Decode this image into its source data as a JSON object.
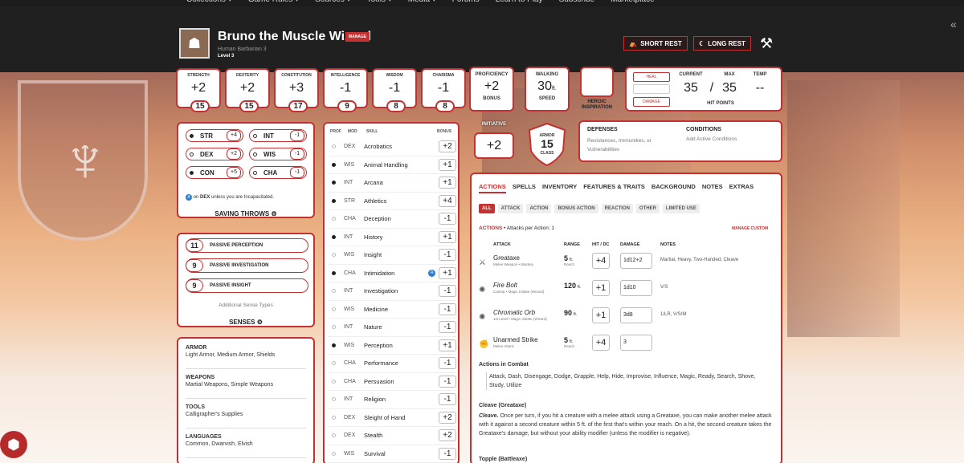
{
  "nav": {
    "items": [
      "Collections ▾",
      "Game Rules ▾",
      "Sources ▾",
      "Tools ▾",
      "Media ▾",
      "Forums",
      "Learn to Play",
      "Subscribe",
      "Marketplace"
    ]
  },
  "character": {
    "name": "Bruno the Muscle Wizard",
    "manage": "MANAGE",
    "subtitle": "Human  Barbarian 3",
    "level": "Level 3"
  },
  "rest": {
    "short": "SHORT REST",
    "long": "LONG REST"
  },
  "abilities": [
    {
      "label": "STRENGTH",
      "mod": "+2",
      "score": "15"
    },
    {
      "label": "DEXTERITY",
      "mod": "+2",
      "score": "15"
    },
    {
      "label": "CONSTITUTION",
      "mod": "+3",
      "score": "17"
    },
    {
      "label": "INTELLIGENCE",
      "mod": "-1",
      "score": "9"
    },
    {
      "label": "WISDOM",
      "mod": "-1",
      "score": "8"
    },
    {
      "label": "CHARISMA",
      "mod": "-1",
      "score": "8"
    }
  ],
  "proficiency": {
    "label": "PROFICIENCY",
    "value": "+2",
    "sub": "BONUS"
  },
  "speed": {
    "label": "WALKING",
    "value": "30",
    "unit": "ft.",
    "sub": "SPEED"
  },
  "heroic": {
    "label": "HEROIC INSPIRATION"
  },
  "hp": {
    "heal": "HEAL",
    "damage": "DAMAGE",
    "current_label": "CURRENT",
    "max_label": "MAX",
    "temp_label": "TEMP",
    "current": "35",
    "sep": "/",
    "max": "35",
    "temp": "--",
    "title": "HIT POINTS"
  },
  "saves": {
    "rows": [
      {
        "name": "STR",
        "value": "+4",
        "prof": true
      },
      {
        "name": "INT",
        "value": "-1",
        "prof": false
      },
      {
        "name": "DEX",
        "value": "+2",
        "prof": false
      },
      {
        "name": "WIS",
        "value": "-1",
        "prof": false
      },
      {
        "name": "CON",
        "value": "+5",
        "prof": true
      },
      {
        "name": "CHA",
        "value": "-1",
        "prof": false
      }
    ],
    "note_pre": "on",
    "note_bold": "DEX",
    "note_post": "unless you are Incapacitated.",
    "title": "SAVING THROWS"
  },
  "senses": {
    "rows": [
      {
        "value": "11",
        "label": "PASSIVE PERCEPTION"
      },
      {
        "value": "9",
        "label": "PASSIVE INVESTIGATION"
      },
      {
        "value": "9",
        "label": "PASSIVE INSIGHT"
      }
    ],
    "additional": "Additional Sense Types",
    "title": "SENSES"
  },
  "proficiencies": [
    {
      "heading": "ARMOR",
      "text": "Light Armor, Medium Armor, Shields"
    },
    {
      "heading": "WEAPONS",
      "text": "Martial Weapons, Simple Weapons"
    },
    {
      "heading": "TOOLS",
      "text": "Calligrapher's Supplies"
    },
    {
      "heading": "LANGUAGES",
      "text": "Common, Dwarvish, Elvish"
    }
  ],
  "skills_header": {
    "prof": "PROF",
    "mod": "MOD",
    "skill": "SKILL",
    "bonus": "BONUS"
  },
  "skills": [
    {
      "mod": "DEX",
      "name": "Acrobatics",
      "bonus": "+2",
      "prof": false
    },
    {
      "mod": "WIS",
      "name": "Animal Handling",
      "bonus": "+1",
      "prof": true
    },
    {
      "mod": "INT",
      "name": "Arcana",
      "bonus": "+1",
      "prof": true
    },
    {
      "mod": "STR",
      "name": "Athletics",
      "bonus": "+4",
      "prof": true
    },
    {
      "mod": "CHA",
      "name": "Deception",
      "bonus": "-1",
      "prof": false
    },
    {
      "mod": "INT",
      "name": "History",
      "bonus": "+1",
      "prof": true
    },
    {
      "mod": "WIS",
      "name": "Insight",
      "bonus": "-1",
      "prof": false
    },
    {
      "mod": "CHA",
      "name": "Intimidation",
      "bonus": "+1",
      "prof": true,
      "adv": "A"
    },
    {
      "mod": "INT",
      "name": "Investigation",
      "bonus": "-1",
      "prof": false
    },
    {
      "mod": "WIS",
      "name": "Medicine",
      "bonus": "-1",
      "prof": false
    },
    {
      "mod": "INT",
      "name": "Nature",
      "bonus": "-1",
      "prof": false
    },
    {
      "mod": "WIS",
      "name": "Perception",
      "bonus": "+1",
      "prof": true
    },
    {
      "mod": "CHA",
      "name": "Performance",
      "bonus": "-1",
      "prof": false
    },
    {
      "mod": "CHA",
      "name": "Persuasion",
      "bonus": "-1",
      "prof": false
    },
    {
      "mod": "INT",
      "name": "Religion",
      "bonus": "-1",
      "prof": false
    },
    {
      "mod": "DEX",
      "name": "Sleight of Hand",
      "bonus": "+2",
      "prof": false
    },
    {
      "mod": "DEX",
      "name": "Stealth",
      "bonus": "+2",
      "prof": false
    },
    {
      "mod": "WIS",
      "name": "Survival",
      "bonus": "-1",
      "prof": false
    }
  ],
  "initiative": {
    "label": "INITIATIVE",
    "value": "+2"
  },
  "armor": {
    "top": "ARMOR",
    "value": "15",
    "bottom": "CLASS"
  },
  "defenses": {
    "title": "DEFENSES",
    "text": "Resistances, Immunities, or Vulnerabilities"
  },
  "conditions": {
    "title": "CONDITIONS",
    "text": "Add Active Conditions"
  },
  "tabs": [
    "ACTIONS",
    "SPELLS",
    "INVENTORY",
    "FEATURES & TRAITS",
    "BACKGROUND",
    "NOTES",
    "EXTRAS"
  ],
  "filters": [
    "ALL",
    "ATTACK",
    "ACTION",
    "BONUS ACTION",
    "REACTION",
    "OTHER",
    "LIMITED USE"
  ],
  "actions": {
    "title": "ACTIONS",
    "per_action": "• Attacks per Action: 1",
    "manage_custom": "MANAGE CUSTOM",
    "col_attack": "ATTACK",
    "col_range": "RANGE",
    "col_hit": "HIT / DC",
    "col_damage": "DAMAGE",
    "col_notes": "NOTES",
    "attacks": [
      {
        "icon": "⚔",
        "name": "Greataxe",
        "sub": "Melee Weapon • Mastery",
        "range": "5",
        "range_unit": "ft.",
        "range_sub": "Reach",
        "hit": "+4",
        "damage": "1d12+2",
        "notes": "Martial, Heavy, Two-Handed, Cleave"
      },
      {
        "icon": "✺",
        "name": "Fire Bolt",
        "sub": "Cantrip • Magic Initiate (Wizard)",
        "range": "120",
        "range_unit": "ft.",
        "range_sub": "",
        "hit": "+1",
        "damage": "1d10",
        "notes": "V/S"
      },
      {
        "icon": "✺",
        "name": "Chromatic Orb",
        "sub": "1st Level • Magic Initiate (Wizard)",
        "range": "90",
        "range_unit": "ft.",
        "range_sub": "",
        "hit": "+1",
        "damage": "3d8",
        "notes": "1/LR, V/S/M"
      },
      {
        "icon": "✊",
        "name": "Unarmed Strike",
        "sub": "Melee Attack",
        "range": "5",
        "range_unit": "ft.",
        "range_sub": "Reach",
        "hit": "+4",
        "damage": "3",
        "notes": ""
      }
    ],
    "combat_title": "Actions in Combat",
    "combat_text": "Attack, Dash, Disengage, Dodge, Grapple, Help, Hide, Improvise, Influence, Magic, Ready, Search, Shove, Study, Utilize",
    "cleave_title": "Cleave (Greataxe)",
    "cleave_lead": "Cleave.",
    "cleave_text": "Once per turn, if you hit a creature with a melee attack using a Greataxe, you can make another melee attack with it against a second creature within 5 ft. of the first that's within your reach. On a hit, the second creature takes the Greataxe's damage, but without your ability modifier (unless the modifier is negative).",
    "topple_title": "Topple (Battleaxe)"
  },
  "colors": {
    "accent": "#c53131",
    "header": "#202020"
  }
}
